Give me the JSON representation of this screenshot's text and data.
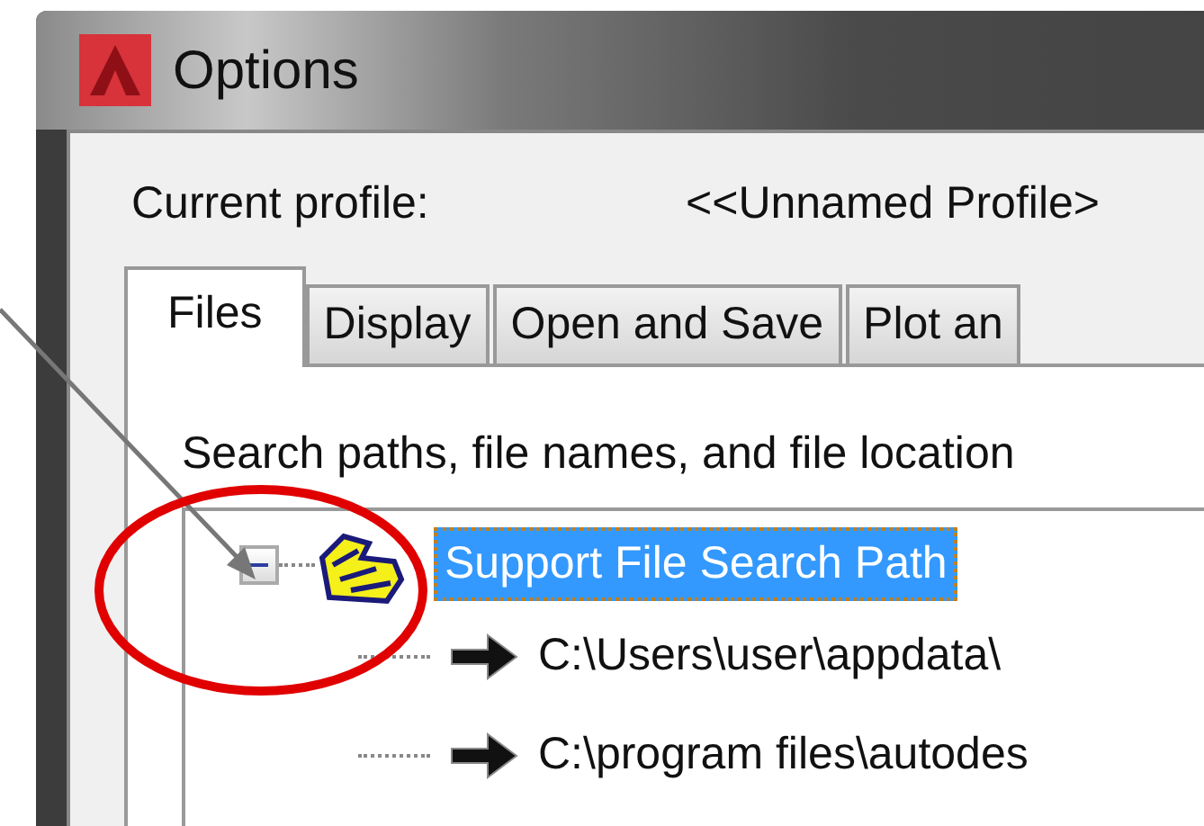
{
  "window": {
    "title": "Options"
  },
  "profile": {
    "label": "Current profile:",
    "value": "<<Unnamed Profile>"
  },
  "tabs": [
    {
      "label": "Files",
      "selected": true
    },
    {
      "label": "Display",
      "selected": false
    },
    {
      "label": "Open and Save",
      "selected": false
    },
    {
      "label": "Plot an",
      "selected": false
    }
  ],
  "description": "Search paths, file names, and file location",
  "tree": [
    {
      "label": "Support File Search Path",
      "expanded": true,
      "selected": true,
      "children": [
        {
          "label": "C:\\Users\\user\\appdata\\"
        },
        {
          "label": "C:\\program files\\autodes"
        }
      ]
    }
  ]
}
